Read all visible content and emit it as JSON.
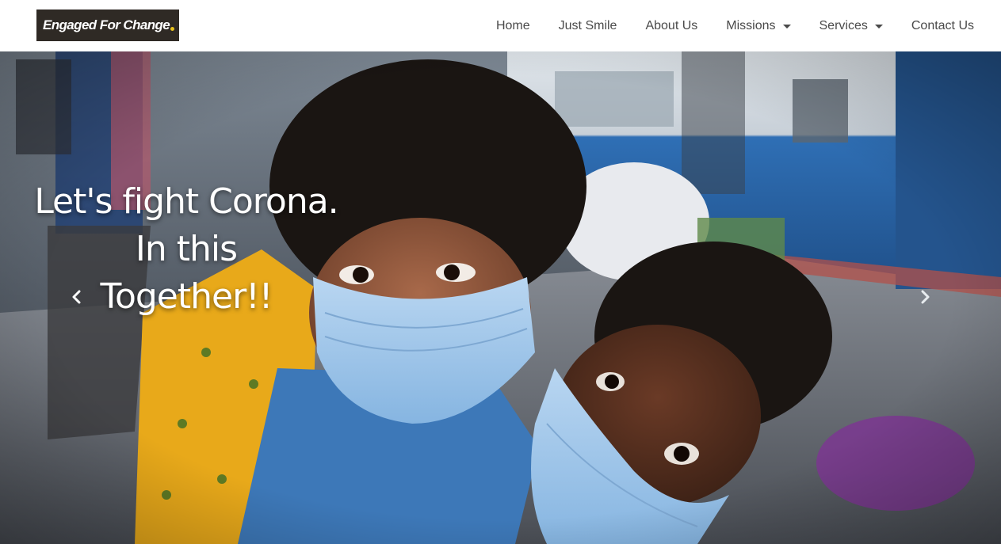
{
  "brand": {
    "name": "Engaged For Change",
    "dot_color": "#e8c21e",
    "bg_color": "#2f2a25"
  },
  "nav": {
    "items": [
      {
        "label": "Home",
        "dropdown": false
      },
      {
        "label": "Just Smile",
        "dropdown": false
      },
      {
        "label": "About Us",
        "dropdown": false
      },
      {
        "label": "Missions",
        "dropdown": true
      },
      {
        "label": "Services",
        "dropdown": true
      },
      {
        "label": "Contact Us",
        "dropdown": false
      }
    ]
  },
  "hero": {
    "caption_lines": [
      "Let's fight Corona.",
      "In this",
      "Together!!"
    ],
    "prev_icon": "chevron-left-icon",
    "next_icon": "chevron-right-icon",
    "photo_description_colors": {
      "train_blue": "#2f6fb5",
      "mask_blue": "#9fc6ea",
      "saree_yellow": "#e8a91a",
      "shirt_blue": "#3d78b8"
    }
  }
}
